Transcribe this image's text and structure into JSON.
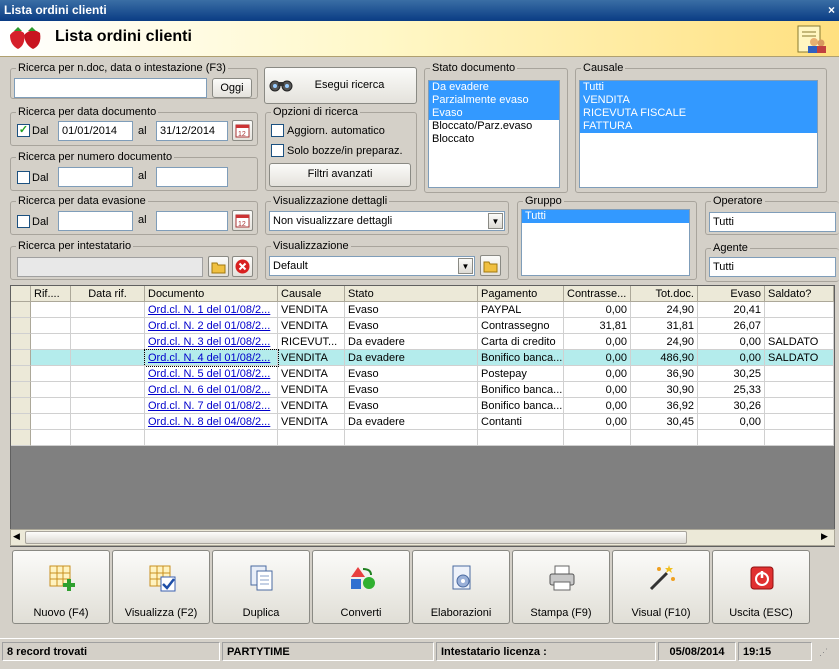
{
  "window": {
    "title": "Lista ordini clienti",
    "close": "×"
  },
  "header": {
    "title": "Lista ordini clienti"
  },
  "search_text": {
    "label": "Ricerca per n.doc, data o intestazione (F3)",
    "value": "",
    "oggi_button": "Oggi"
  },
  "search_button": "Esegui ricerca",
  "date_doc": {
    "label": "Ricerca per data documento",
    "checked": true,
    "dal_label": "Dal",
    "from": "01/01/2014",
    "al_label": "al",
    "to": "31/12/2014"
  },
  "num_doc": {
    "label": "Ricerca per numero documento",
    "dal_label": "Dal",
    "al_label": "al",
    "from": "",
    "to": ""
  },
  "date_evas": {
    "label": "Ricerca per data evasione",
    "dal_label": "Dal",
    "al_label": "al",
    "from": "",
    "to": ""
  },
  "intestatario": {
    "label": "Ricerca per intestatario",
    "value": ""
  },
  "options": {
    "label": "Opzioni di ricerca",
    "auto_update": "Aggiorn. automatico",
    "drafts_only": "Solo bozze/in preparaz.",
    "advanced_filters": "Filtri avanzati"
  },
  "stato_doc": {
    "label": "Stato documento",
    "items": [
      {
        "text": "Da evadere",
        "selected": true
      },
      {
        "text": "Parzialmente evaso",
        "selected": true
      },
      {
        "text": "Evaso",
        "selected": true
      },
      {
        "text": "Bloccato/Parz.evaso",
        "selected": false
      },
      {
        "text": "Bloccato",
        "selected": false
      }
    ]
  },
  "causale": {
    "label": "Causale",
    "items": [
      {
        "text": "Tutti",
        "selected": true
      },
      {
        "text": "VENDITA",
        "selected": true
      },
      {
        "text": "RICEVUTA FISCALE",
        "selected": true
      },
      {
        "text": "FATTURA",
        "selected": true
      }
    ]
  },
  "vis_dettagli": {
    "label": "Visualizzazione dettagli",
    "value": "Non visualizzare dettagli"
  },
  "visualizzazione": {
    "label": "Visualizzazione",
    "value": "Default"
  },
  "gruppo": {
    "label": "Gruppo",
    "items": [
      {
        "text": "Tutti",
        "selected": true
      }
    ]
  },
  "operatore": {
    "label": "Operatore",
    "value": "Tutti"
  },
  "agente": {
    "label": "Agente",
    "value": "Tutti"
  },
  "grid": {
    "columns": [
      "Rif....",
      "Data rif.",
      "Documento",
      "Causale",
      "Stato",
      "Pagamento",
      "Contrasse...",
      "Tot.doc.",
      "Evaso",
      "Saldato?"
    ],
    "rows": [
      {
        "rif": "",
        "data_rif": "",
        "documento": "Ord.cl. N. 1 del 01/08/2...",
        "causale": "VENDITA",
        "stato": "Evaso",
        "pagamento": "PAYPAL",
        "contrassegno": "0,00",
        "totdoc": "24,90",
        "evaso": "20,41",
        "saldato": ""
      },
      {
        "rif": "",
        "data_rif": "",
        "documento": "Ord.cl. N. 2 del 01/08/2...",
        "causale": "VENDITA",
        "stato": "Evaso",
        "pagamento": "Contrassegno",
        "contrassegno": "31,81",
        "totdoc": "31,81",
        "evaso": "26,07",
        "saldato": ""
      },
      {
        "rif": "",
        "data_rif": "",
        "documento": "Ord.cl. N. 3 del 01/08/2...",
        "causale": "RICEVUT...",
        "stato": "Da evadere",
        "pagamento": "Carta di credito",
        "contrassegno": "0,00",
        "totdoc": "24,90",
        "evaso": "0,00",
        "saldato": "SALDATO"
      },
      {
        "rif": "",
        "data_rif": "",
        "documento": "Ord.cl. N. 4 del 01/08/2...",
        "causale": "VENDITA",
        "stato": "Da evadere",
        "pagamento": "Bonifico banca...",
        "contrassegno": "0,00",
        "totdoc": "486,90",
        "evaso": "0,00",
        "saldato": "SALDATO",
        "highlight": true
      },
      {
        "rif": "",
        "data_rif": "",
        "documento": "Ord.cl. N. 5 del 01/08/2...",
        "causale": "VENDITA",
        "stato": "Evaso",
        "pagamento": "Postepay",
        "contrassegno": "0,00",
        "totdoc": "36,90",
        "evaso": "30,25",
        "saldato": ""
      },
      {
        "rif": "",
        "data_rif": "",
        "documento": "Ord.cl. N. 6 del 01/08/2...",
        "causale": "VENDITA",
        "stato": "Evaso",
        "pagamento": "Bonifico banca...",
        "contrassegno": "0,00",
        "totdoc": "30,90",
        "evaso": "25,33",
        "saldato": ""
      },
      {
        "rif": "",
        "data_rif": "",
        "documento": "Ord.cl. N. 7 del 01/08/2...",
        "causale": "VENDITA",
        "stato": "Evaso",
        "pagamento": "Bonifico banca...",
        "contrassegno": "0,00",
        "totdoc": "36,92",
        "evaso": "30,26",
        "saldato": ""
      },
      {
        "rif": "",
        "data_rif": "",
        "documento": "Ord.cl. N. 8 del 04/08/2...",
        "causale": "VENDITA",
        "stato": "Da evadere",
        "pagamento": "Contanti",
        "contrassegno": "0,00",
        "totdoc": "30,45",
        "evaso": "0,00",
        "saldato": ""
      }
    ]
  },
  "toolbar": [
    {
      "label": "Nuovo (F4)",
      "icon": "new-grid-icon"
    },
    {
      "label": "Visualizza (F2)",
      "icon": "view-grid-icon"
    },
    {
      "label": "Duplica",
      "icon": "duplicate-icon"
    },
    {
      "label": "Converti",
      "icon": "convert-icon"
    },
    {
      "label": "Elaborazioni",
      "icon": "processing-icon"
    },
    {
      "label": "Stampa (F9)",
      "icon": "printer-icon"
    },
    {
      "label": "Visual (F10)",
      "icon": "magic-wand-icon"
    },
    {
      "label": "Uscita (ESC)",
      "icon": "exit-icon"
    }
  ],
  "status": {
    "records": "8 record trovati",
    "company": "PARTYTIME",
    "license": "Intestatario licenza :",
    "date": "05/08/2014",
    "time": "19:15"
  }
}
